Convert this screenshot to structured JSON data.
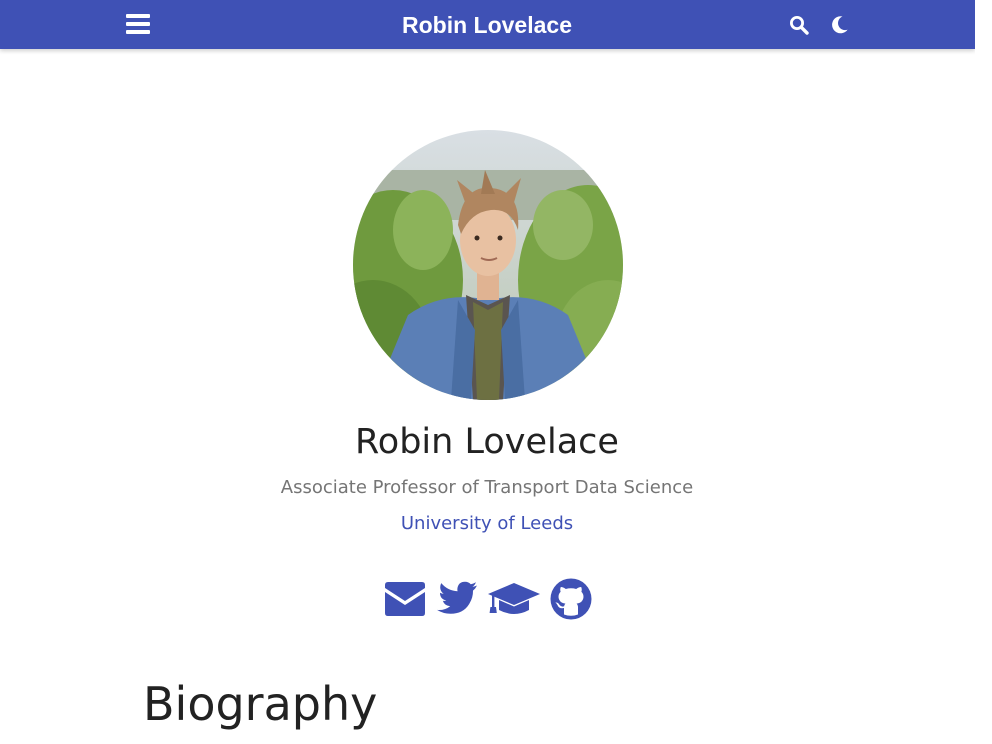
{
  "navbar": {
    "brand": "Robin Lovelace",
    "menu_icon": "bars-icon",
    "search_icon": "search-icon",
    "theme_icon": "moon-icon",
    "background_color": "#3f51b5"
  },
  "profile": {
    "avatar_alt": "avatar",
    "name": "Robin Lovelace",
    "role": "Associate Professor of Transport Data Science",
    "organization": "University of Leeds",
    "accent_color": "#3f51b5"
  },
  "social": [
    {
      "icon": "envelope-icon"
    },
    {
      "icon": "twitter-icon"
    },
    {
      "icon": "graduation-cap-icon"
    },
    {
      "icon": "github-icon"
    }
  ],
  "sections": {
    "biography_title": "Biography"
  }
}
